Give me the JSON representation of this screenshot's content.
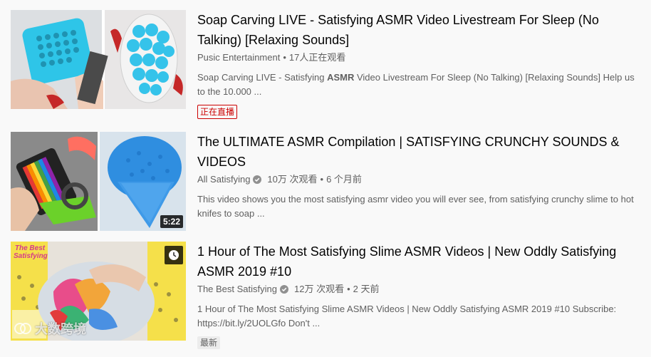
{
  "videos": [
    {
      "title": "Soap Carving LIVE - Satisfying ASMR Video Livestream For Sleep (No Talking) [Relaxing Sounds]",
      "channel": "Pusic Entertainment",
      "stats": "17人正在观看",
      "desc_pre": "Soap Carving LIVE - Satisfying ",
      "desc_bold": "ASMR",
      "desc_post": " Video Livestream For Sleep (No Talking) [Relaxing Sounds] Help us to the 10.000 ...",
      "badge": "正在直播"
    },
    {
      "title": "The ULTIMATE ASMR Compilation | SATISFYING CRUNCHY SOUNDS & VIDEOS",
      "channel": "All Satisfying",
      "views": "10万 次观看",
      "age": "6 个月前",
      "desc": "This video shows you the most satisfying asmr video you will ever see, from satisfying crunchy slime to hot knifes to soap ...",
      "duration": "5:22"
    },
    {
      "title": "1 Hour of The Most Satisfying Slime ASMR Videos | New Oddly Satisfying ASMR 2019 #10",
      "channel": "The Best Satisfying",
      "views": "12万 次观看",
      "age": "2 天前",
      "desc": "1 Hour of The Most Satisfying Slime ASMR Videos | New Oddly Satisfying ASMR 2019 #10 Subscribe: https://bit.ly/2UOLGfo Don't ...",
      "badge": "最新",
      "thumb_text": "The Best Satisfying"
    }
  ],
  "watermark": "大数跨境",
  "separator": "•",
  "colors": {
    "live": "#cc0000",
    "meta": "#606060",
    "title": "#030303"
  }
}
